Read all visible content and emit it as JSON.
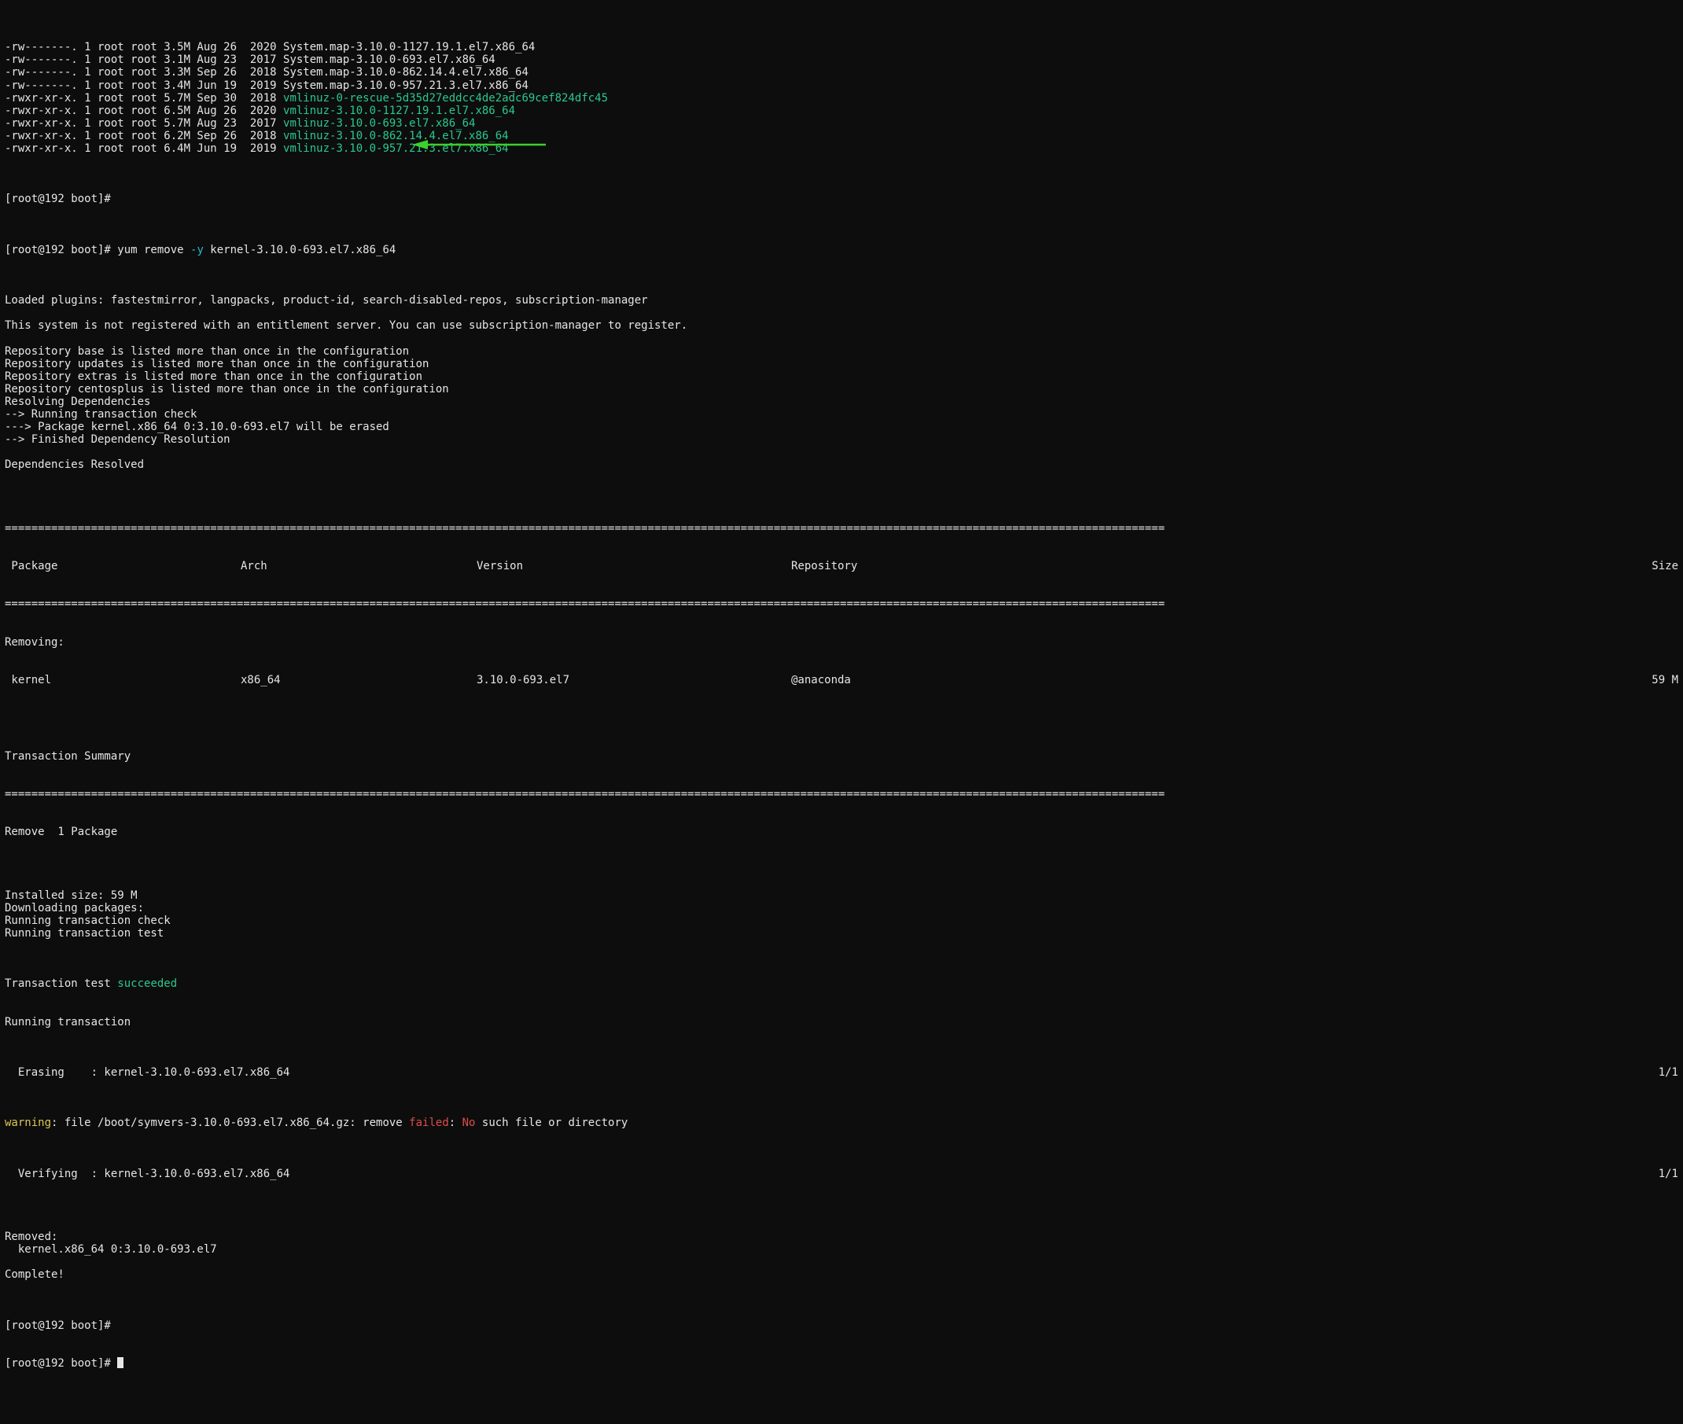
{
  "colors": {
    "green": "#29c98f",
    "cyan": "#2eb6c7",
    "yellow": "#e0c74f",
    "red": "#e04b4b"
  },
  "ls": [
    {
      "perm": "-rw-------.",
      "links": "1",
      "owner": "root",
      "group": "root",
      "size": "3.5M",
      "month": "Aug",
      "day": "26",
      "year": "2020",
      "name": "System.map-3.10.0-1127.19.1.el7.x86_64",
      "exec": false
    },
    {
      "perm": "-rw-------.",
      "links": "1",
      "owner": "root",
      "group": "root",
      "size": "3.1M",
      "month": "Aug",
      "day": "23",
      "year": "2017",
      "name": "System.map-3.10.0-693.el7.x86_64",
      "exec": false
    },
    {
      "perm": "-rw-------.",
      "links": "1",
      "owner": "root",
      "group": "root",
      "size": "3.3M",
      "month": "Sep",
      "day": "26",
      "year": "2018",
      "name": "System.map-3.10.0-862.14.4.el7.x86_64",
      "exec": false
    },
    {
      "perm": "-rw-------.",
      "links": "1",
      "owner": "root",
      "group": "root",
      "size": "3.4M",
      "month": "Jun",
      "day": "19",
      "year": "2019",
      "name": "System.map-3.10.0-957.21.3.el7.x86_64",
      "exec": false
    },
    {
      "perm": "-rwxr-xr-x.",
      "links": "1",
      "owner": "root",
      "group": "root",
      "size": "5.7M",
      "month": "Sep",
      "day": "30",
      "year": "2018",
      "name": "vmlinuz-0-rescue-5d35d27eddcc4de2adc69cef824dfc45",
      "exec": true
    },
    {
      "perm": "-rwxr-xr-x.",
      "links": "1",
      "owner": "root",
      "group": "root",
      "size": "6.5M",
      "month": "Aug",
      "day": "26",
      "year": "2020",
      "name": "vmlinuz-3.10.0-1127.19.1.el7.x86_64",
      "exec": true
    },
    {
      "perm": "-rwxr-xr-x.",
      "links": "1",
      "owner": "root",
      "group": "root",
      "size": "5.7M",
      "month": "Aug",
      "day": "23",
      "year": "2017",
      "name": "vmlinuz-3.10.0-693.el7.x86_64",
      "exec": true
    },
    {
      "perm": "-rwxr-xr-x.",
      "links": "1",
      "owner": "root",
      "group": "root",
      "size": "6.2M",
      "month": "Sep",
      "day": "26",
      "year": "2018",
      "name": "vmlinuz-3.10.0-862.14.4.el7.x86_64",
      "exec": true
    },
    {
      "perm": "-rwxr-xr-x.",
      "links": "1",
      "owner": "root",
      "group": "root",
      "size": "6.4M",
      "month": "Jun",
      "day": "19",
      "year": "2019",
      "name": "vmlinuz-3.10.0-957.21.3.el7.x86_64",
      "exec": true
    }
  ],
  "prompt": "[root@192 boot]#",
  "cmd": {
    "pre": " yum remove ",
    "flag": "-y",
    "post": " kernel-3.10.0-693.el7.x86_64"
  },
  "out1": [
    "Loaded plugins: fastestmirror, langpacks, product-id, search-disabled-repos, subscription-manager",
    "",
    "This system is not registered with an entitlement server. You can use subscription-manager to register.",
    "",
    "Repository base is listed more than once in the configuration",
    "Repository updates is listed more than once in the configuration",
    "Repository extras is listed more than once in the configuration",
    "Repository centosplus is listed more than once in the configuration",
    "Resolving Dependencies",
    "--> Running transaction check",
    "---> Package kernel.x86_64 0:3.10.0-693.el7 will be erased",
    "--> Finished Dependency Resolution",
    "",
    "Dependencies Resolved",
    ""
  ],
  "rule": "===============================================================================================================================================================================",
  "hdr": {
    "c0": " Package",
    "c1": "Arch",
    "c2": "Version",
    "c3": "Repository",
    "c4": "Size"
  },
  "removing_label": "Removing:",
  "pkg": {
    "c0": " kernel",
    "c1": "x86_64",
    "c2": "3.10.0-693.el7",
    "c3": "@anaconda",
    "c4": "59 M"
  },
  "txsum": "Transaction Summary",
  "remove_line": "Remove  1 Package",
  "out2": [
    "",
    "Installed size: 59 M",
    "Downloading packages:",
    "Running transaction check",
    "Running transaction test"
  ],
  "tx_test_pre": "Transaction test ",
  "tx_test_ok": "succeeded",
  "running_tx": "Running transaction",
  "erase": {
    "left": "  Erasing    : kernel-3.10.0-693.el7.x86_64",
    "right": "1/1"
  },
  "warn": {
    "w": "warning",
    "mid": ": file /boot/symvers-3.10.0-693.el7.x86_64.gz: remove ",
    "fail": "failed",
    "sep": ": ",
    "no": "No",
    "tail": " such file or directory"
  },
  "verify": {
    "left": "  Verifying  : kernel-3.10.0-693.el7.x86_64",
    "right": "1/1"
  },
  "out3": [
    "",
    "Removed:",
    "  kernel.x86_64 0:3.10.0-693.el7",
    "",
    "Complete!"
  ]
}
